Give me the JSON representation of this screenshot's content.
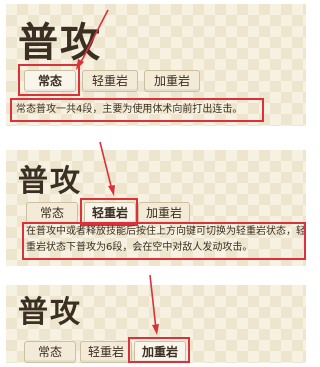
{
  "panels": [
    {
      "title": "普攻",
      "tabs": [
        "常态",
        "轻重岩",
        "加重岩"
      ],
      "active": 0,
      "description": "常态普攻一共4段，主要为使用体术向前打出连击。"
    },
    {
      "title": "普攻",
      "tabs": [
        "常态",
        "轻重岩",
        "加重岩"
      ],
      "active": 1,
      "description": "在普攻中或者释放技能后按住上方向键可切换为轻重岩状态，轻重岩状态下普攻为6段，会在空中对敌人发动攻击。"
    },
    {
      "title": "普攻",
      "tabs": [
        "常态",
        "轻重岩",
        "加重岩"
      ],
      "active": 2
    }
  ],
  "colors": {
    "highlight": "#d9323a",
    "panel": "#f7f1e1",
    "text": "#3b2e22"
  }
}
